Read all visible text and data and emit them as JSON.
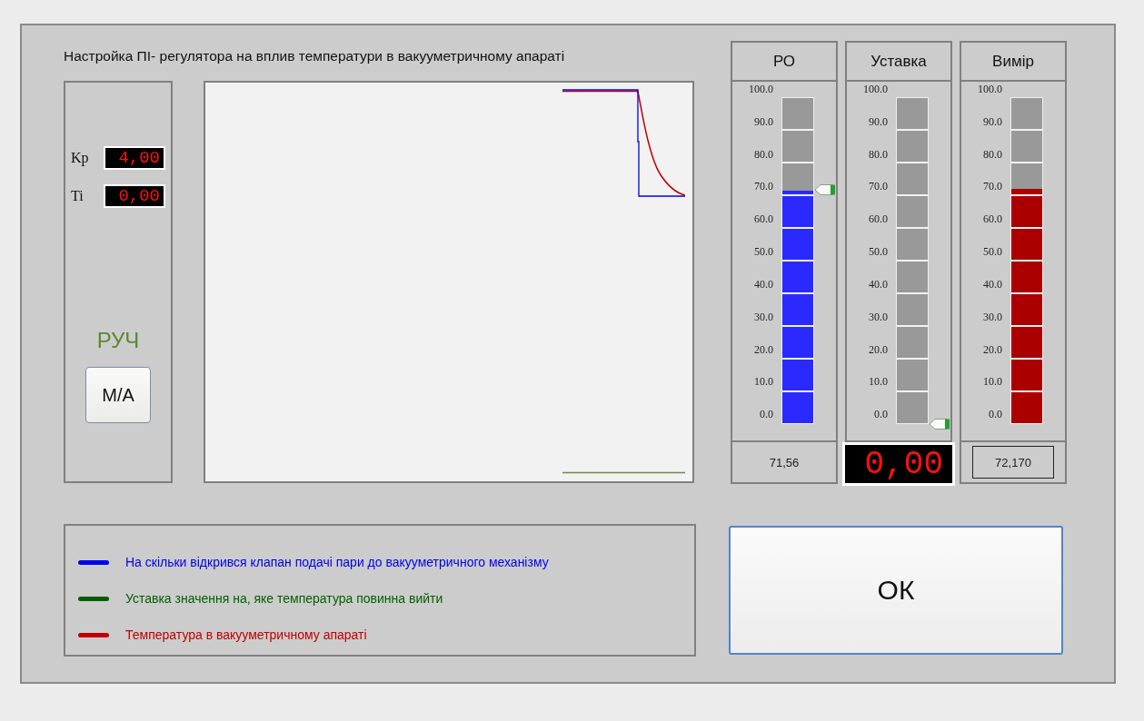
{
  "title": "Настройка ПІ- регулятора на вплив температури в вакууметричному апараті",
  "tuning": {
    "params": [
      {
        "label": "Kp",
        "value": "4,00"
      },
      {
        "label": "Ti",
        "value": "0,00"
      }
    ],
    "mode": "РУЧ",
    "mode_button": "M/A"
  },
  "gauges": [
    {
      "title": "РО",
      "ticks": [
        "100.0",
        "90.0",
        "80.0",
        "70.0",
        "60.0",
        "50.0",
        "40.0",
        "30.0",
        "20.0",
        "10.0",
        "0.0"
      ],
      "level": 0.7156,
      "color": "#2a2aff",
      "pointer": true,
      "readout": "71,56",
      "kind": "plain"
    },
    {
      "title": "Уставка",
      "ticks": [
        "100.0",
        "90.0",
        "80.0",
        "70.0",
        "60.0",
        "50.0",
        "40.0",
        "30.0",
        "20.0",
        "10.0",
        "0.0"
      ],
      "level": 0,
      "pointer": true,
      "readout": "0,00",
      "kind": "digital"
    },
    {
      "title": "Вимір",
      "ticks": [
        "100.0",
        "90.0",
        "80.0",
        "70.0",
        "60.0",
        "50.0",
        "40.0",
        "30.0",
        "20.0",
        "10.0",
        "0.0"
      ],
      "level": 0.7217,
      "color": "#aa0000",
      "pointer": false,
      "readout": "72,170",
      "kind": "boxed"
    }
  ],
  "legend": [
    {
      "color": "#0000ee",
      "label": "На скільки відкрився клапан подачі пари до вакууметричного механізму"
    },
    {
      "color": "#006000",
      "label": "Уставка значення на, яке температура повинна вийти"
    },
    {
      "color": "#c00000",
      "label": "Температура в вакууметричному апараті"
    }
  ],
  "ok_button": "ОК"
}
